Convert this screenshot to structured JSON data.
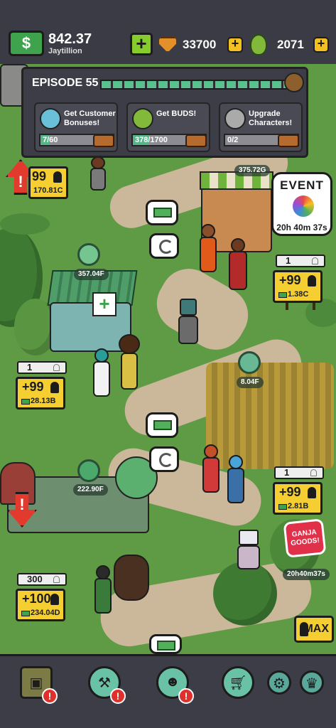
{
  "top_bar": {
    "money": "842.37",
    "username": "Jaytillion",
    "gems": "33700",
    "buds": "2071"
  },
  "episode": {
    "title": "EPISODE 55",
    "tasks": [
      {
        "label": "Get Customer Bonuses!",
        "progress": "7/60",
        "fraction": 0.117
      },
      {
        "label": "Get BUDS!",
        "progress": "378/1700",
        "fraction": 0.222
      },
      {
        "label": "Upgrade Characters!",
        "progress": "0/2",
        "fraction": 0.0
      }
    ]
  },
  "production": {
    "top_center": "375.72G",
    "shop": "357.04F",
    "field": "8.04F",
    "factory": "222.90F"
  },
  "event": {
    "title": "EVENT",
    "timer": "20h 40m 37s"
  },
  "upgrades": {
    "top_left": {
      "level": "99",
      "cost": "170.81C"
    },
    "right_1": {
      "count": "1",
      "level": "+99",
      "cost": "1.38C"
    },
    "left_2": {
      "count": "1",
      "level": "+99",
      "cost": "28.13B"
    },
    "right_2": {
      "count": "1",
      "level": "+99",
      "cost": "2.81B"
    },
    "left_3": {
      "count": "300",
      "level": "+100",
      "cost": "234.04D"
    }
  },
  "ganja_goods": {
    "label": "GANJA GOODS!",
    "timer": "20h40m37s"
  },
  "max_button": "MAX",
  "icons": {
    "money": "$",
    "plus": "+",
    "alert": "!"
  },
  "colors": {
    "accent_yellow": "#f5cf32",
    "money_green": "#3fa34d",
    "alert_red": "#e23b2e"
  }
}
